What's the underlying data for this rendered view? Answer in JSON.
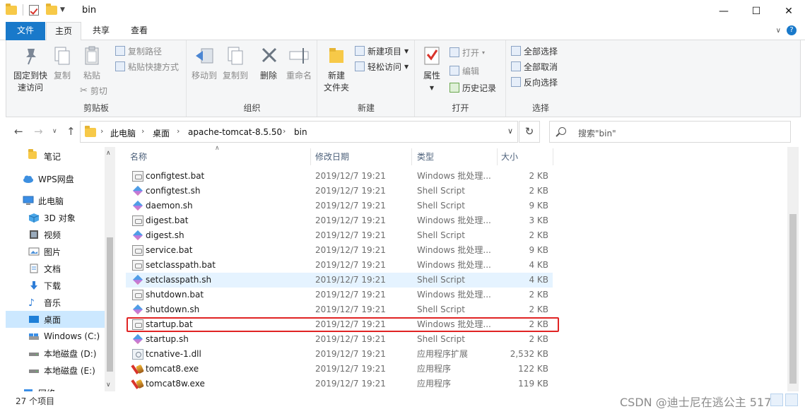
{
  "window": {
    "title": "bin",
    "minimize": "—",
    "maximize": "☐",
    "close": "✕"
  },
  "tabs": {
    "file": "文件",
    "home": "主页",
    "share": "共享",
    "view": "查看"
  },
  "ribbon": {
    "clipboard": {
      "label": "剪贴板",
      "pin_line1": "固定到快",
      "pin_line2": "速访问",
      "copy": "复制",
      "paste": "粘贴",
      "copy_path": "复制路径",
      "paste_shortcut": "粘贴快捷方式",
      "cut": "剪切"
    },
    "organize": {
      "label": "组织",
      "move_to": "移动到",
      "copy_to": "复制到",
      "delete": "删除",
      "rename": "重命名"
    },
    "new": {
      "label": "新建",
      "new_folder_line1": "新建",
      "new_folder_line2": "文件夹",
      "new_item": "新建项目",
      "easy_access": "轻松访问"
    },
    "open": {
      "label": "打开",
      "properties": "属性",
      "open": "打开",
      "edit": "编辑",
      "history": "历史记录"
    },
    "select": {
      "label": "选择",
      "select_all": "全部选择",
      "select_none": "全部取消",
      "invert": "反向选择"
    }
  },
  "address": {
    "crumbs": [
      "此电脑",
      "桌面",
      "apache-tomcat-8.5.50",
      "bin"
    ],
    "search_placeholder": "搜索\"bin\""
  },
  "nav": {
    "items": [
      {
        "label": "笔记",
        "icon": "folder-icon"
      },
      {
        "label": "WPS网盘",
        "icon": "cloud-icon"
      },
      {
        "label": "此电脑",
        "icon": "computer-icon"
      },
      {
        "label": "3D 对象",
        "icon": "cube-icon"
      },
      {
        "label": "视频",
        "icon": "video-icon"
      },
      {
        "label": "图片",
        "icon": "picture-icon"
      },
      {
        "label": "文档",
        "icon": "document-icon"
      },
      {
        "label": "下载",
        "icon": "download-icon"
      },
      {
        "label": "音乐",
        "icon": "music-icon"
      },
      {
        "label": "桌面",
        "icon": "desktop-icon"
      },
      {
        "label": "Windows (C:)",
        "icon": "drive-icon"
      },
      {
        "label": "本地磁盘 (D:)",
        "icon": "drive-icon"
      },
      {
        "label": "本地磁盘 (E:)",
        "icon": "drive-icon"
      },
      {
        "label": "网络",
        "icon": "network-icon"
      }
    ]
  },
  "columns": {
    "name": "名称",
    "date": "修改日期",
    "type": "类型",
    "size": "大小"
  },
  "files": [
    {
      "name": "configtest.bat",
      "date": "2019/12/7 19:21",
      "type": "Windows 批处理...",
      "size": "2 KB",
      "kind": "bat"
    },
    {
      "name": "configtest.sh",
      "date": "2019/12/7 19:21",
      "type": "Shell Script",
      "size": "2 KB",
      "kind": "sh"
    },
    {
      "name": "daemon.sh",
      "date": "2019/12/7 19:21",
      "type": "Shell Script",
      "size": "9 KB",
      "kind": "sh"
    },
    {
      "name": "digest.bat",
      "date": "2019/12/7 19:21",
      "type": "Windows 批处理...",
      "size": "3 KB",
      "kind": "bat"
    },
    {
      "name": "digest.sh",
      "date": "2019/12/7 19:21",
      "type": "Shell Script",
      "size": "2 KB",
      "kind": "sh"
    },
    {
      "name": "service.bat",
      "date": "2019/12/7 19:21",
      "type": "Windows 批处理...",
      "size": "9 KB",
      "kind": "bat"
    },
    {
      "name": "setclasspath.bat",
      "date": "2019/12/7 19:21",
      "type": "Windows 批处理...",
      "size": "4 KB",
      "kind": "bat"
    },
    {
      "name": "setclasspath.sh",
      "date": "2019/12/7 19:21",
      "type": "Shell Script",
      "size": "4 KB",
      "kind": "sh"
    },
    {
      "name": "shutdown.bat",
      "date": "2019/12/7 19:21",
      "type": "Windows 批处理...",
      "size": "2 KB",
      "kind": "bat"
    },
    {
      "name": "shutdown.sh",
      "date": "2019/12/7 19:21",
      "type": "Shell Script",
      "size": "2 KB",
      "kind": "sh"
    },
    {
      "name": "startup.bat",
      "date": "2019/12/7 19:21",
      "type": "Windows 批处理...",
      "size": "2 KB",
      "kind": "bat"
    },
    {
      "name": "startup.sh",
      "date": "2019/12/7 19:21",
      "type": "Shell Script",
      "size": "2 KB",
      "kind": "sh"
    },
    {
      "name": "tcnative-1.dll",
      "date": "2019/12/7 19:21",
      "type": "应用程序扩展",
      "size": "2,532 KB",
      "kind": "dll"
    },
    {
      "name": "tomcat8.exe",
      "date": "2019/12/7 19:21",
      "type": "应用程序",
      "size": "122 KB",
      "kind": "exe"
    },
    {
      "name": "tomcat8w.exe",
      "date": "2019/12/7 19:21",
      "type": "应用程序",
      "size": "119 KB",
      "kind": "exe"
    }
  ],
  "status": {
    "count": "27 个项目"
  },
  "watermark": "CSDN @迪士尼在逃公主 517"
}
